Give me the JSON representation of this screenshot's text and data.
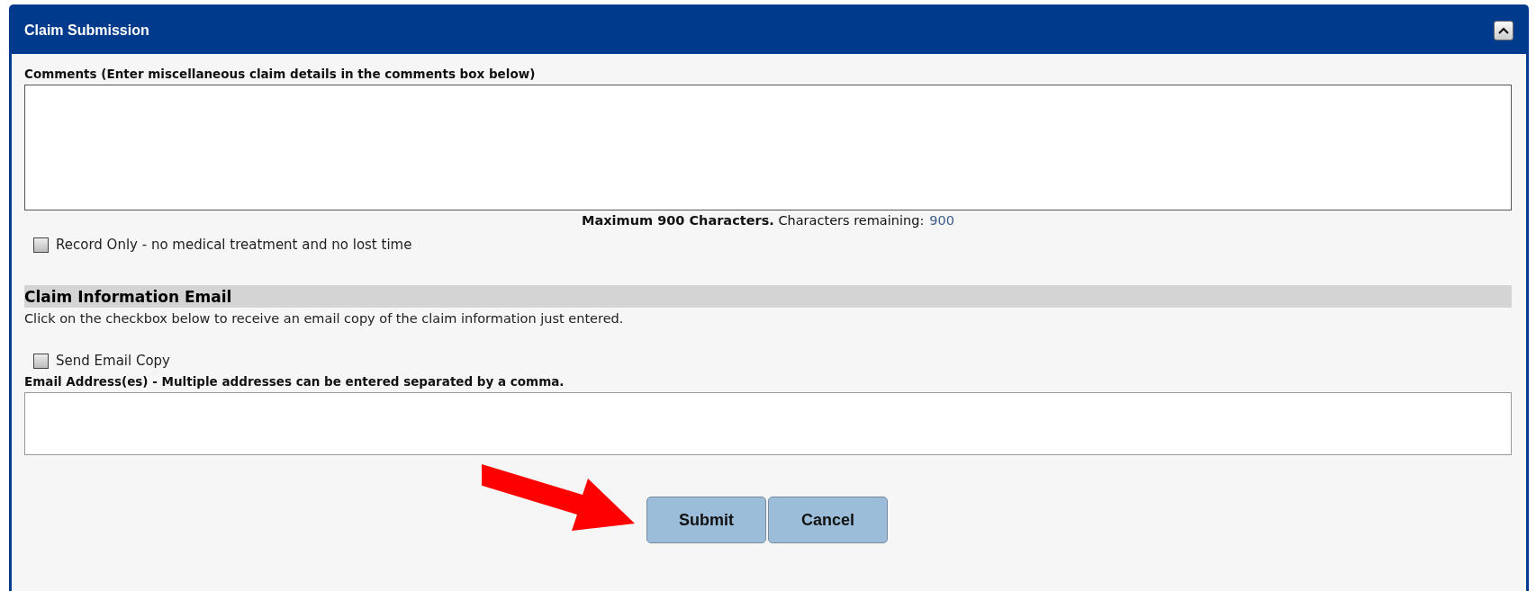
{
  "panel": {
    "title": "Claim Submission",
    "expanded": true
  },
  "comments": {
    "label": "Comments (Enter miscellaneous claim details in the comments box below)",
    "note": "**Maximum 900 Characters.** Characters remaining:",
    "remaining": "900"
  },
  "record_only": {
    "label": "Record Only - no medical treatment and no lost time",
    "checked": false
  },
  "email_section": {
    "heading": "Claim Information Email",
    "description": "Click on the checkbox below to receive an email copy of the claim information just entered.",
    "send_copy": {
      "label": "Send Email Copy",
      "checked": false
    },
    "address_label": "Email Address(es) - Multiple addresses can be entered separated by a comma."
  },
  "buttons": [
    {
      "label": "Submit"
    },
    {
      "label": "Cancel"
    }
  ]
}
